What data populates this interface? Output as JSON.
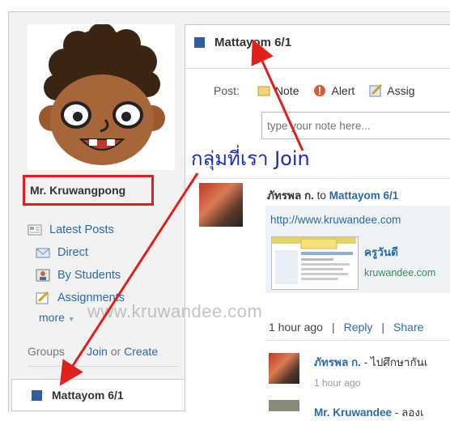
{
  "user": {
    "name": "Mr. Kruwangpong"
  },
  "nav": {
    "latest_posts": "Latest Posts",
    "direct": "Direct",
    "by_students": "By Students",
    "assignments": "Assignments",
    "more": "more"
  },
  "groups": {
    "label": "Groups",
    "join": "Join",
    "or": "or",
    "create": "Create",
    "items": [
      {
        "name": "Mattayom 6/1"
      }
    ]
  },
  "panel": {
    "title": "Mattayom 6/1"
  },
  "post": {
    "label": "Post:",
    "buttons": {
      "note": "Note",
      "alert": "Alert",
      "assignment": "Assig"
    },
    "input_placeholder": "type your note here..."
  },
  "annotation": {
    "text": "กลุ่มที่เรา Join"
  },
  "watermark": "www.kruwandee.com",
  "feed": [
    {
      "author": "ภัทรพล ก.",
      "to_word": "to",
      "group": "Mattayom 6/1",
      "link": {
        "url": "http://www.kruwandee.com",
        "title": "ครูวันดี",
        "domain": "kruwandee.com"
      },
      "time": "1 hour ago",
      "reply": "Reply",
      "share": "Share",
      "comments": [
        {
          "author": "ภัทรพล ก.",
          "text": " - ไปศึกษากันเ",
          "time": "1 hour ago"
        },
        {
          "author": "Mr. Kruwandee",
          "text": " - ลองเ"
        }
      ]
    }
  ]
}
